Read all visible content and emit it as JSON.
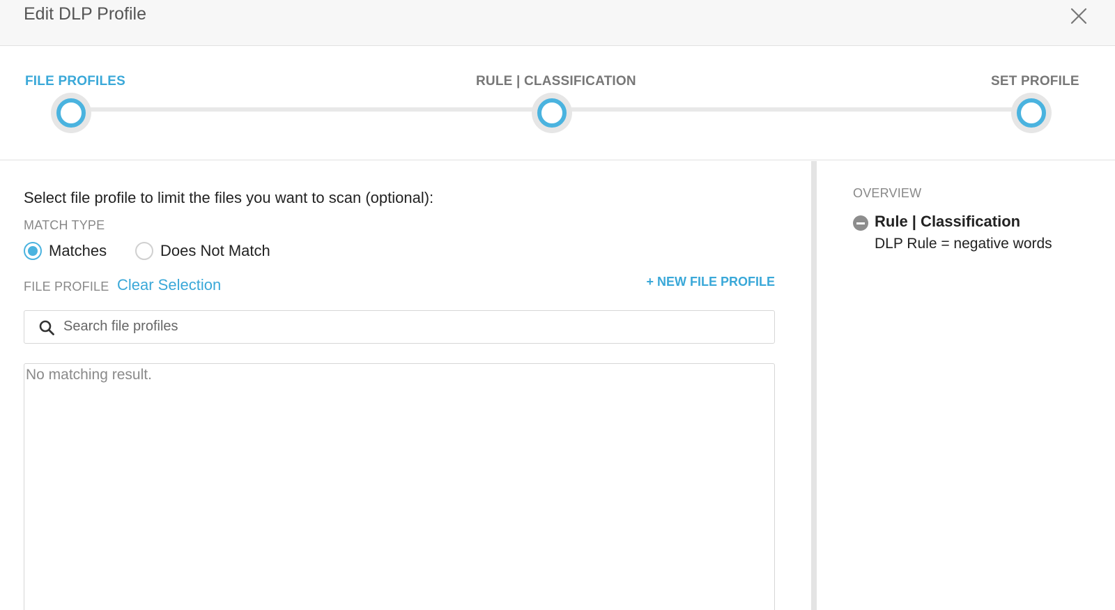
{
  "header": {
    "title": "Edit DLP Profile"
  },
  "stepper": {
    "steps": [
      {
        "label": "FILE PROFILES",
        "active": true
      },
      {
        "label": "RULE | CLASSIFICATION",
        "active": false
      },
      {
        "label": "SET PROFILE",
        "active": false
      }
    ]
  },
  "main": {
    "instruction": "Select file profile to limit the files you want to scan (optional):",
    "match_type_label": "MATCH TYPE",
    "match_options": [
      {
        "label": "Matches",
        "selected": true
      },
      {
        "label": "Does Not Match",
        "selected": false
      }
    ],
    "file_profile_label": "FILE PROFILE",
    "clear_selection": "Clear Selection",
    "new_file_profile": "+ NEW FILE PROFILE",
    "search": {
      "placeholder": "Search file profiles",
      "value": ""
    },
    "empty_result": "No matching result."
  },
  "overview": {
    "label": "OVERVIEW",
    "items": [
      {
        "title": "Rule | Classification",
        "detail": "DLP Rule = negative words"
      }
    ]
  },
  "colors": {
    "accent": "#4ab3df",
    "link": "#3aa8d8",
    "muted_text": "#888888",
    "header_bg": "#f7f7f7"
  },
  "icons": {
    "close": "close-icon",
    "search": "search-icon",
    "remove": "minus-circle-icon"
  }
}
